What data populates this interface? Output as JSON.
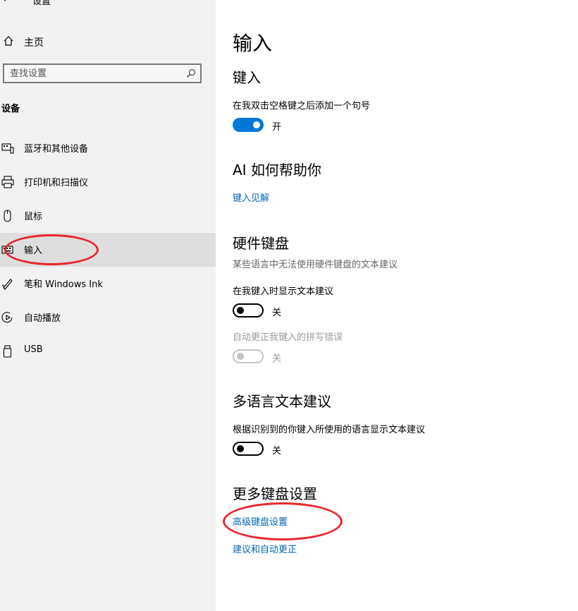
{
  "window": {
    "title": "设置"
  },
  "sidebar": {
    "home_label": "主页",
    "search_placeholder": "查找设置",
    "section_label": "设备",
    "items": [
      {
        "label": "蓝牙和其他设备",
        "icon": "bluetooth-devices-icon"
      },
      {
        "label": "打印机和扫描仪",
        "icon": "printer-icon"
      },
      {
        "label": "鼠标",
        "icon": "mouse-icon"
      },
      {
        "label": "输入",
        "icon": "keyboard-icon",
        "selected": true
      },
      {
        "label": "笔和 Windows Ink",
        "icon": "pen-icon"
      },
      {
        "label": "自动播放",
        "icon": "autoplay-icon"
      },
      {
        "label": "USB",
        "icon": "usb-icon"
      }
    ]
  },
  "main": {
    "title": "输入",
    "typing": {
      "heading": "键入",
      "setting_label": "在我双击空格键之后添加一个句号",
      "toggle_state": "开"
    },
    "ai": {
      "heading": "AI 如何帮助你",
      "link": "键入见解"
    },
    "hardware_keyboard": {
      "heading": "硬件键盘",
      "description": "某些语言中无法使用硬件键盘的文本建议",
      "show_suggestions_label": "在我键入时显示文本建议",
      "show_suggestions_state": "关",
      "autocorrect_label": "自动更正我键入的拼写错误",
      "autocorrect_state": "关"
    },
    "multilingual": {
      "heading": "多语言文本建议",
      "setting_label": "根据识别到的你键入所使用的语言显示文本建议",
      "toggle_state": "关"
    },
    "more_keyboard": {
      "heading": "更多键盘设置",
      "advanced_link": "高级键盘设置",
      "suggestions_link": "建议和自动更正"
    }
  },
  "colors": {
    "accent": "#0078d7",
    "link": "#0067b8",
    "annotation": "#e8262f"
  }
}
